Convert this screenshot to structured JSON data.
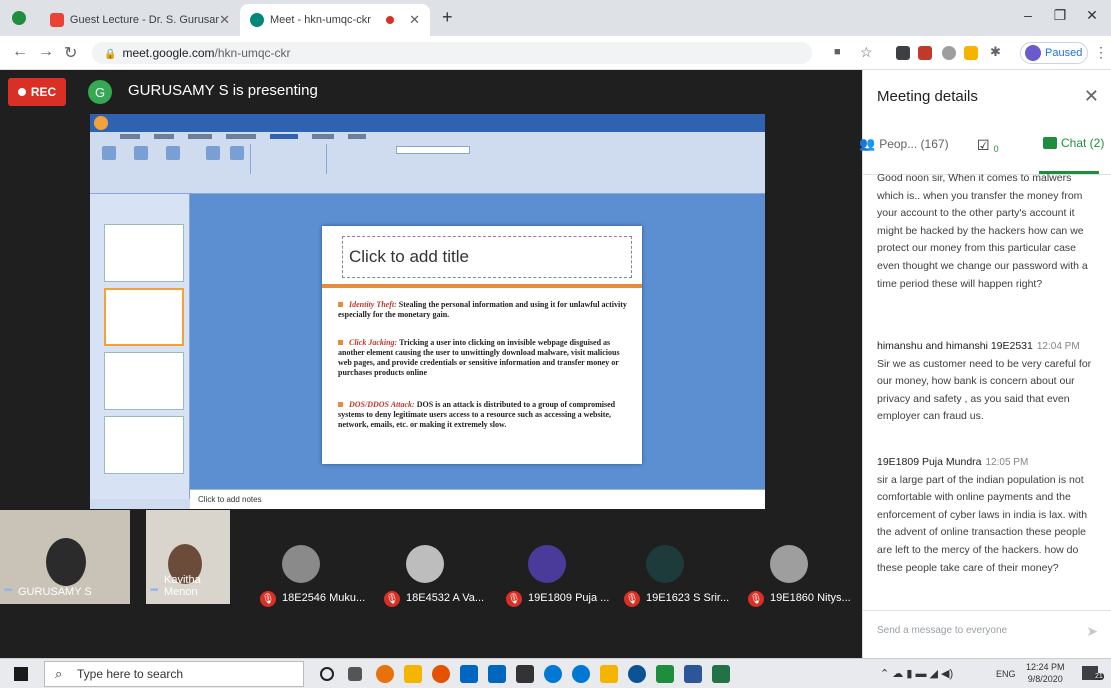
{
  "browser": {
    "tabs": [
      {
        "title": "Guest Lecture - Dr. S. Gurusamy",
        "active": false
      },
      {
        "title": "Meet - hkn-umqc-ckr",
        "active": true
      }
    ],
    "new_tab": "+",
    "url_host": "meet.google.com",
    "url_path": "/hkn-umqc-ckr",
    "profile_status": "Paused",
    "window_controls": {
      "minimize": "–",
      "maximize": "❐",
      "close": "✕"
    }
  },
  "meet": {
    "rec_label": "REC",
    "presenter_initial": "G",
    "presenter_text": "GURUSAMY S is presenting",
    "slide": {
      "title_placeholder": "Click to add title",
      "bullets": [
        {
          "head": "Identity Theft:",
          "text": " Stealing the personal information and using it for unlawful activity especially for the monetary gain."
        },
        {
          "head": "Click Jacking:",
          "text": " Tricking a user into clicking on invisible webpage disguised as another element causing the user to unwittingly download malware, visit malicious web pages, and provide credentials or sensitive information and transfer money or purchases products online"
        },
        {
          "head": "DOS/DDOS Attack:",
          "text": " DOS is an attack is distributed to a group of compromised systems to deny legitimate users access to a resource such as accessing a website, network, emails, etc. or making it extremely slow."
        }
      ],
      "notes_placeholder": "Click to add notes"
    },
    "video_tiles": [
      {
        "name": "GURUSAMY S"
      },
      {
        "name": "Kavitha Menon"
      }
    ],
    "participants": [
      {
        "name": "18E2546 Muku..."
      },
      {
        "name": "18E4532 A Va..."
      },
      {
        "name": "19E1809 Puja ..."
      },
      {
        "name": "19E1623 S Srir..."
      },
      {
        "name": "19E1860 Nitys..."
      }
    ]
  },
  "panel": {
    "title": "Meeting details",
    "tabs": {
      "people": "Peop... (167)",
      "activities_count": "0",
      "chat": "Chat (2)"
    },
    "messages": [
      {
        "sender": "",
        "time": "",
        "text": "Good noon sir, When it comes to malwers which is.. when you transfer the money from your account to the other party's account it might be hacked by the hackers how can we protect our money from this particular case even thought we change our password with a time period these will happen right?"
      },
      {
        "sender": "himanshu and himanshi 19E2531",
        "time": "12:04 PM",
        "text": "Sir we as customer need to be very careful for our money, how bank is concern about our privacy and safety , as you said that even employer can fraud us."
      },
      {
        "sender": "19E1809 Puja Mundra",
        "time": "12:05 PM",
        "text": "sir a large part of the indian population is not comfortable with online payments and the enforcement of cyber laws in india is lax. with the advent of online transaction these people are left to the mercy of the hackers. how do these people take care of their money?"
      }
    ],
    "compose_placeholder": "Send a message to everyone",
    "send_icon": "➤"
  },
  "taskbar": {
    "search_placeholder": "Type here to search",
    "tray_lang": "ENG",
    "time": "12:24 PM",
    "date": "9/8/2020",
    "notifications": "21"
  },
  "colors": {
    "rec": "#d93025",
    "chat_accent": "#1e8e3e",
    "meet_bg": "#1f1f1f"
  }
}
